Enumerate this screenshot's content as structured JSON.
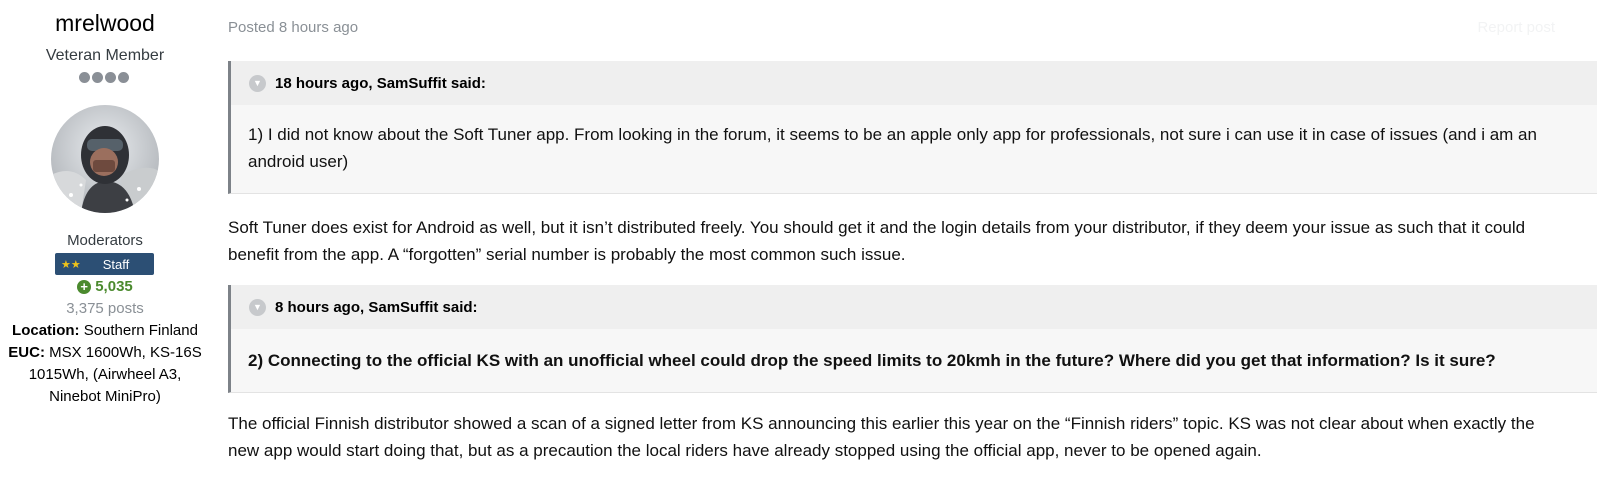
{
  "author": {
    "name": "mrelwood",
    "title": "Veteran Member",
    "rank_pips": 4,
    "group": "Moderators",
    "badge_stars": "★★",
    "badge_label": "Staff",
    "reputation_icon": "plus-circle-icon",
    "reputation": "5,035",
    "posts": "3,375 posts",
    "location_label": "Location:",
    "location_value": "Southern Finland",
    "euc_label": "EUC:",
    "euc_value_1": "MSX 1600Wh, KS-16S",
    "euc_value_2": "1015Wh, (Airwheel A3,",
    "euc_value_3": "Ninebot MiniPro)"
  },
  "post": {
    "meta": "Posted 8 hours ago",
    "report": "Report post",
    "quote_toggle_icon": "chevron-down-icon",
    "quotes": [
      {
        "citation": "18 hours ago, SamSuffit said:",
        "text": "1) I did not know about the Soft Tuner app. From looking in the forum, it seems to be an apple only app for professionals, not sure i can use it in case of issues (and i am an android user)"
      },
      {
        "citation": "8 hours ago, SamSuffit said:",
        "text": "2) Connecting to the official KS with an unofficial wheel could drop the speed limits to 20kmh in the future? Where did you get that information? Is it sure?"
      }
    ],
    "paragraphs": [
      "Soft Tuner does exist for Android as well, but it isn’t distributed freely. You should get it and the login details from your distributor, if they deem your issue as such that it could benefit from the app. A “forgotten” serial number is probably the most common such issue.",
      "The official Finnish distributor showed a scan of a signed letter from KS announcing this earlier this year on the “Finnish riders” topic. KS was not clear about when exactly the new app would start doing that, but as a precaution the local riders have already stopped using the official app, never to be opened again."
    ]
  },
  "colors": {
    "staff_badge": "#2c4f74",
    "reputation": "#4b8a2e",
    "quote_border": "#7d8288"
  }
}
